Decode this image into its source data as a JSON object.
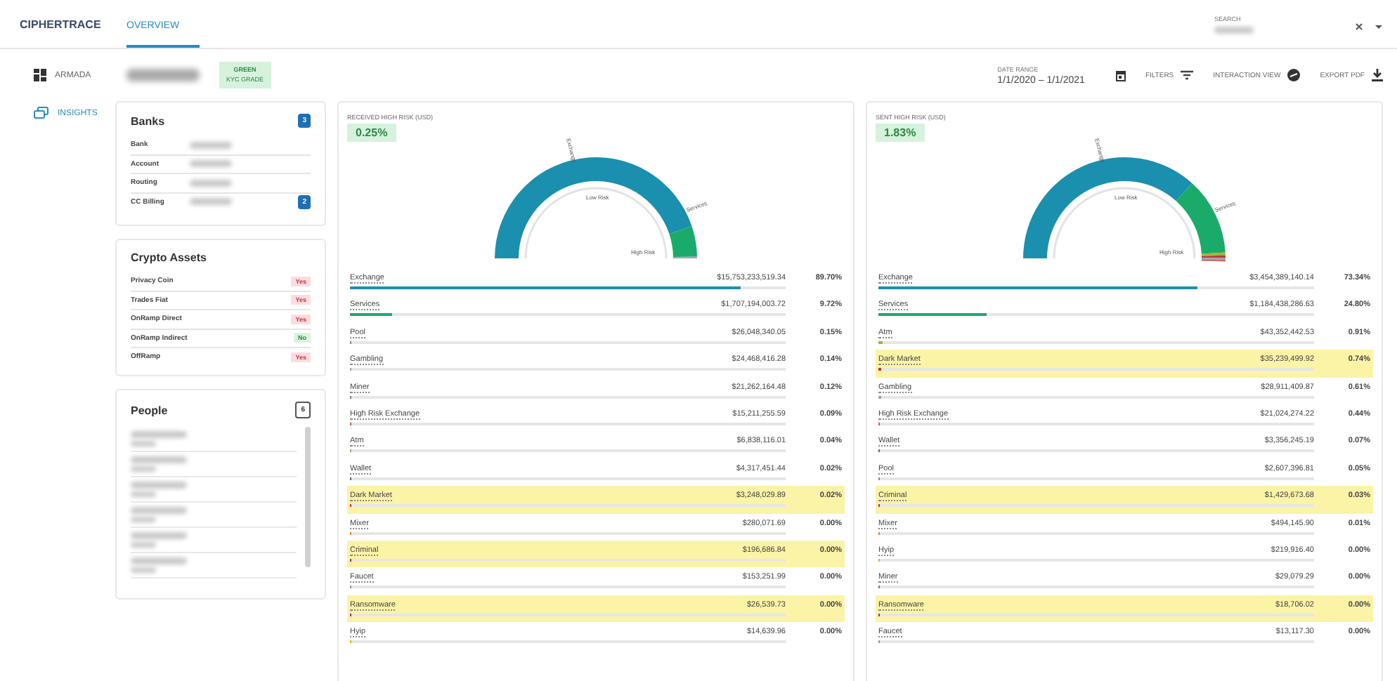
{
  "brand": {
    "name": "CIPHERTRACE"
  },
  "tabs": [
    {
      "label": "OVERVIEW",
      "selected": true
    }
  ],
  "search": {
    "label": "SEARCH"
  },
  "sidebar": {
    "items": [
      {
        "label": "ARMADA",
        "selected": false
      },
      {
        "label": "INSIGHTS",
        "selected": true
      }
    ]
  },
  "entity": {
    "grade": "GREEN",
    "grade_label": "KYC GRADE"
  },
  "toolbar": {
    "date_label": "DATE RANGE",
    "date_range": "1/1/2020 – 1/1/2021",
    "actions": [
      {
        "label": "FILTERS"
      },
      {
        "label": "INTERACTION VIEW"
      },
      {
        "label": "EXPORT PDF"
      }
    ]
  },
  "banks": {
    "title": "Banks",
    "count": "3",
    "rows": [
      {
        "label": "Bank"
      },
      {
        "label": "Account"
      },
      {
        "label": "Routing"
      },
      {
        "label": "CC Billing",
        "count": "2"
      }
    ]
  },
  "crypto_assets": {
    "title": "Crypto Assets",
    "rows": [
      {
        "label": "Privacy Coin",
        "value": "Yes",
        "flagged": true
      },
      {
        "label": "Trades Fiat",
        "value": "Yes",
        "flagged": true
      },
      {
        "label": "OnRamp Direct",
        "value": "Yes",
        "flagged": true
      },
      {
        "label": "OnRamp Indirect",
        "value": "No",
        "flagged": false
      },
      {
        "label": "OffRamp",
        "value": "Yes",
        "flagged": true
      }
    ]
  },
  "people": {
    "title": "People",
    "count": "6"
  },
  "panels": [
    {
      "title": "RECEIVED HIGH RISK (USD)",
      "value": "0.25%",
      "gauge_labels": {
        "top": "Exchange",
        "right": "Services",
        "inner": "Low Risk",
        "end": "High Risk"
      },
      "rows": [
        {
          "label": "Exchange",
          "amount": "$15,753,233,519.34",
          "percent": "89.70%",
          "level": 0.897,
          "color": "#1b8fae",
          "highlighted": false
        },
        {
          "label": "Services",
          "amount": "$1,707,194,003.72",
          "percent": "9.72%",
          "level": 0.0972,
          "color": "#1aab6a",
          "highlighted": false
        },
        {
          "label": "Pool",
          "amount": "$26,048,340.05",
          "percent": "0.15%",
          "level": 0.0015,
          "color": "#7a8fa6",
          "highlighted": false
        },
        {
          "label": "Gambling",
          "amount": "$24,468,416.28",
          "percent": "0.14%",
          "level": 0.0014,
          "color": "#9aa6b2",
          "highlighted": false
        },
        {
          "label": "Miner",
          "amount": "$21,262,164.48",
          "percent": "0.12%",
          "level": 0.0012,
          "color": "#6e7f91",
          "highlighted": false
        },
        {
          "label": "High Risk Exchange",
          "amount": "$15,211,255.59",
          "percent": "0.09%",
          "level": 0.0009,
          "color": "#d9534f",
          "highlighted": false
        },
        {
          "label": "Atm",
          "amount": "$6,838,116.01",
          "percent": "0.04%",
          "level": 0.0004,
          "color": "#a0b43c",
          "highlighted": false
        },
        {
          "label": "Wallet",
          "amount": "$4,317,451.44",
          "percent": "0.02%",
          "level": 0.0002,
          "color": "#5a6b7c",
          "highlighted": false
        },
        {
          "label": "Dark Market",
          "amount": "$3,248,029.89",
          "percent": "0.02%",
          "level": 0.0002,
          "color": "#c0392b",
          "highlighted": true
        },
        {
          "label": "Mixer",
          "amount": "$280,071.69",
          "percent": "0.00%",
          "level": 0,
          "color": "#e08a2c",
          "highlighted": false
        },
        {
          "label": "Criminal",
          "amount": "$196,686.84",
          "percent": "0.00%",
          "level": 0,
          "color": "#b03060",
          "highlighted": true
        },
        {
          "label": "Faucet",
          "amount": "$153,251.99",
          "percent": "0.00%",
          "level": 0,
          "color": "#8e9aa5",
          "highlighted": false
        },
        {
          "label": "Ransomware",
          "amount": "$26,539.73",
          "percent": "0.00%",
          "level": 0,
          "color": "#9b2d8c",
          "highlighted": true
        },
        {
          "label": "Hyip",
          "amount": "$14,639.96",
          "percent": "0.00%",
          "level": 0,
          "color": "#e0b020",
          "highlighted": false
        }
      ]
    },
    {
      "title": "SENT HIGH RISK (USD)",
      "value": "1.83%",
      "gauge_labels": {
        "top": "Exchange",
        "right": "Services",
        "inner": "Low Risk",
        "end": "High Risk"
      },
      "rows": [
        {
          "label": "Exchange",
          "amount": "$3,454,389,140.14",
          "percent": "73.34%",
          "level": 0.7334,
          "color": "#1b8fae",
          "highlighted": false
        },
        {
          "label": "Services",
          "amount": "$1,184,438,286.63",
          "percent": "24.80%",
          "level": 0.248,
          "color": "#1aab6a",
          "highlighted": false
        },
        {
          "label": "Atm",
          "amount": "$43,352,442.53",
          "percent": "0.91%",
          "level": 0.0091,
          "color": "#a0b43c",
          "highlighted": false
        },
        {
          "label": "Dark Market",
          "amount": "$35,239,499.92",
          "percent": "0.74%",
          "level": 0.0074,
          "color": "#c0392b",
          "highlighted": true
        },
        {
          "label": "Gambling",
          "amount": "$28,911,409.87",
          "percent": "0.61%",
          "level": 0.0061,
          "color": "#9aa6b2",
          "highlighted": false
        },
        {
          "label": "High Risk Exchange",
          "amount": "$21,024,274.22",
          "percent": "0.44%",
          "level": 0.0044,
          "color": "#d9534f",
          "highlighted": false
        },
        {
          "label": "Wallet",
          "amount": "$3,356,245.19",
          "percent": "0.07%",
          "level": 0.0007,
          "color": "#5a6b7c",
          "highlighted": false
        },
        {
          "label": "Pool",
          "amount": "$2,607,396.81",
          "percent": "0.05%",
          "level": 0.0005,
          "color": "#7a8fa6",
          "highlighted": false
        },
        {
          "label": "Criminal",
          "amount": "$1,429,673.68",
          "percent": "0.03%",
          "level": 0.0003,
          "color": "#b03060",
          "highlighted": true
        },
        {
          "label": "Mixer",
          "amount": "$494,145.90",
          "percent": "0.01%",
          "level": 0.0001,
          "color": "#e08a2c",
          "highlighted": false
        },
        {
          "label": "Hyip",
          "amount": "$219,916.40",
          "percent": "0.00%",
          "level": 0,
          "color": "#e0b020",
          "highlighted": false
        },
        {
          "label": "Miner",
          "amount": "$29,079.29",
          "percent": "0.00%",
          "level": 0,
          "color": "#6e7f91",
          "highlighted": false
        },
        {
          "label": "Ransomware",
          "amount": "$18,706.02",
          "percent": "0.00%",
          "level": 0,
          "color": "#9b2d8c",
          "highlighted": true
        },
        {
          "label": "Faucet",
          "amount": "$13,117.30",
          "percent": "0.00%",
          "level": 0,
          "color": "#8e9aa5",
          "highlighted": false
        }
      ]
    }
  ]
}
